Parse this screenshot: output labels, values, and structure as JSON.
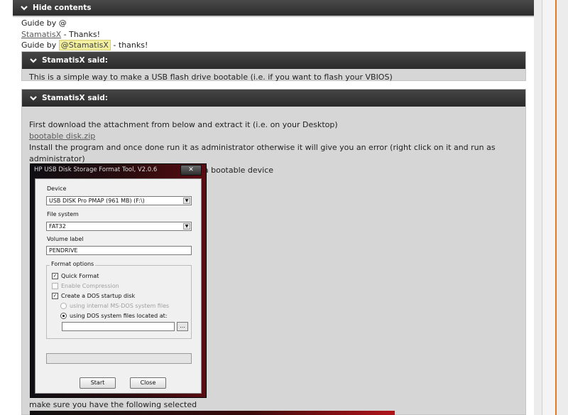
{
  "hide_contents": {
    "label": "Hide contents"
  },
  "lines": {
    "guide_prefix": "Guide by @",
    "stamatis_link": "StamatisX",
    "thanks1": " - Thanks!",
    "guide_by": "Guide by ",
    "mention": "@StamatisX",
    "thanks2": " - thanks!"
  },
  "quote1": {
    "author": "StamatisX said:",
    "text": "This is a simple way to make a USB flash drive bootable (i.e. if you want to flash your VBIOS)"
  },
  "quote2": {
    "author": "StamatisX said:",
    "line1": "First download the attachment from below and extract it (i.e. on your Desktop)",
    "attachment": "bootable disk.zip",
    "line2": "Install the program and once done run it as administrator otherwise it will give you an error (right click on it and run as administrator)",
    "line3": "Insert the USB flash disk you want to use as a bootable device"
  },
  "dialog": {
    "title": "HP USB Disk Storage Format Tool, V2.0.6",
    "close_symbol": "✕",
    "device_label": "Device",
    "device_value": "USB DISK Pro PMAP (961 MB) (F:\\)",
    "fs_label": "File system",
    "fs_value": "FAT32",
    "volume_label": "Volume label",
    "volume_value": "PENDRIVE",
    "format_options": "Format options",
    "quick_format": "Quick Format",
    "enable_compression": "Enable Compression",
    "create_dos": "Create a DOS startup disk",
    "internal_dos": "using internal MS-DOS system files",
    "dos_located": "using DOS system files located at:",
    "browse": "...",
    "start": "Start",
    "close": "Close",
    "arrow": "▼"
  },
  "after": {
    "text": "make sure you have the following selected"
  },
  "colors": {
    "accent_orange": "#e07a20",
    "mention_bg": "#f3f0a0"
  },
  "icons": {
    "chevron": "chevron-down-icon",
    "close": "close-icon"
  }
}
